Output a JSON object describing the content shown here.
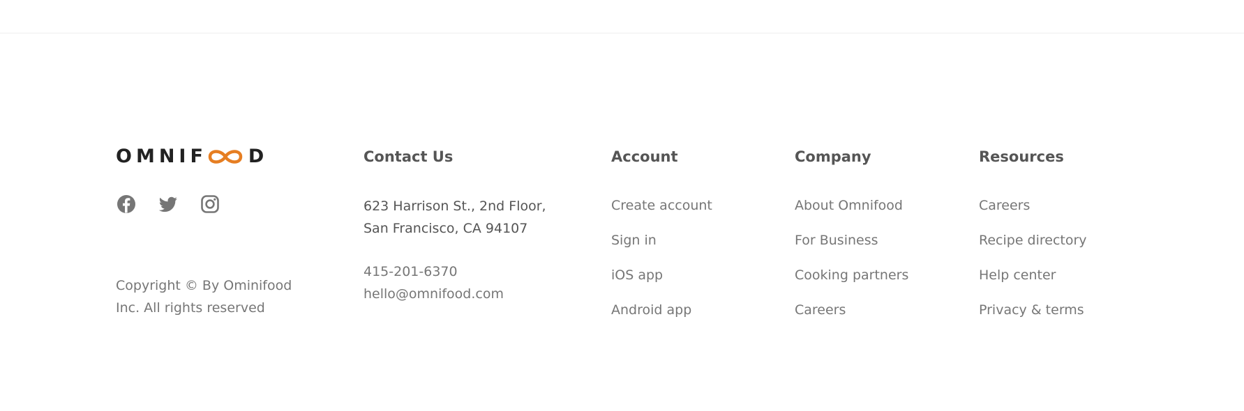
{
  "brand": {
    "letters_before": "OMNIF",
    "letters_after": "D",
    "accent_color": "#e67e22",
    "text_color": "#222222"
  },
  "social": [
    {
      "icon": "facebook-icon"
    },
    {
      "icon": "twitter-icon"
    },
    {
      "icon": "instagram-icon"
    }
  ],
  "copyright": "Copyright © By Ominifood Inc. All rights reserved",
  "contact": {
    "heading": "Contact Us",
    "address_line1": "623 Harrison St., 2nd Floor,",
    "address_line2": "San Francisco, CA 94107",
    "phone": "415-201-6370",
    "email": "hello@omnifood.com"
  },
  "account": {
    "heading": "Account",
    "links": [
      "Create account",
      "Sign in",
      "iOS app",
      "Android app"
    ]
  },
  "company": {
    "heading": "Company",
    "links": [
      "About Omnifood",
      "For Business",
      "Cooking partners",
      "Careers"
    ]
  },
  "resources": {
    "heading": "Resources",
    "links": [
      "Careers",
      "Recipe directory",
      "Help center",
      "Privacy & terms"
    ]
  }
}
